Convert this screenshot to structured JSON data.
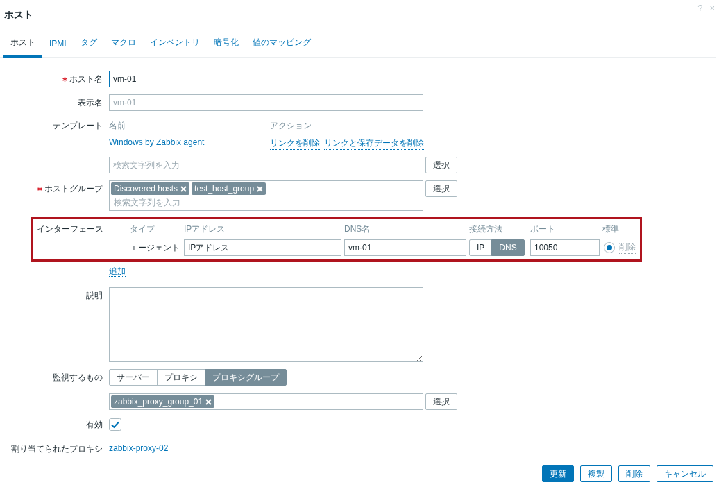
{
  "dialog": {
    "title": "ホスト",
    "help": "?",
    "close": "×"
  },
  "tabs": [
    {
      "label": "ホスト",
      "selected": true
    },
    {
      "label": "IPMI",
      "selected": false
    },
    {
      "label": "タグ",
      "selected": false
    },
    {
      "label": "マクロ",
      "selected": false
    },
    {
      "label": "インベントリ",
      "selected": false
    },
    {
      "label": "暗号化",
      "selected": false
    },
    {
      "label": "値のマッピング",
      "selected": false
    }
  ],
  "rows": [
    {
      "kind": "input",
      "label": "ホスト名",
      "required": true,
      "value": "vm-01",
      "focused": true
    },
    {
      "kind": "input",
      "label": "表示名",
      "required": false,
      "placeholder": "vm-01",
      "focused": false
    },
    {
      "kind": "templates",
      "label": "テンプレート",
      "columns": [
        "名前",
        "アクション"
      ],
      "items": [
        {
          "name": "Windows by Zabbix agent",
          "actions": [
            "リンクを削除",
            "リンクと保存データを削除"
          ]
        }
      ],
      "placeholder": "検索文字列を入力",
      "select_button": "選択"
    },
    {
      "kind": "multiselect",
      "label": "ホストグループ",
      "required": true,
      "chips": [
        "Discovered hosts",
        "test_host_group"
      ],
      "placeholder": "検索文字列を入力",
      "select_button": "選択"
    },
    {
      "kind": "interfaces",
      "label": "インターフェース",
      "highlighted": true,
      "columns": [
        "タイプ",
        "IPアドレス",
        "DNS名",
        "接続方法",
        "ポート",
        "標準"
      ],
      "items": [
        {
          "type": "エージェント",
          "ip": "IPアドレス",
          "dns": "vm-01",
          "connect": [
            {
              "label": "IP",
              "selected": false
            },
            {
              "label": "DNS",
              "selected": true
            }
          ],
          "port": "10050",
          "default": true,
          "remove": "削除",
          "remove_disabled": true
        }
      ],
      "add": "追加"
    },
    {
      "kind": "textarea",
      "label": "説明"
    },
    {
      "kind": "segmented",
      "label": "監視するもの",
      "options": [
        {
          "label": "サーバー",
          "selected": false
        },
        {
          "label": "プロキシ",
          "selected": false
        },
        {
          "label": "プロキシグループ",
          "selected": true
        }
      ]
    },
    {
      "kind": "multiselect",
      "chips": [
        "zabbix_proxy_group_01"
      ],
      "select_button": "選択"
    },
    {
      "kind": "checkbox",
      "label": "有効",
      "checked": true
    },
    {
      "kind": "link",
      "label": "割り当てられたプロキシ",
      "value": "zabbix-proxy-02"
    }
  ],
  "buttons": [
    {
      "label": "更新",
      "kind": "primary"
    },
    {
      "label": "複製",
      "kind": "secondary"
    },
    {
      "label": "削除",
      "kind": "secondary"
    },
    {
      "label": "キャンセル",
      "kind": "secondary"
    }
  ]
}
